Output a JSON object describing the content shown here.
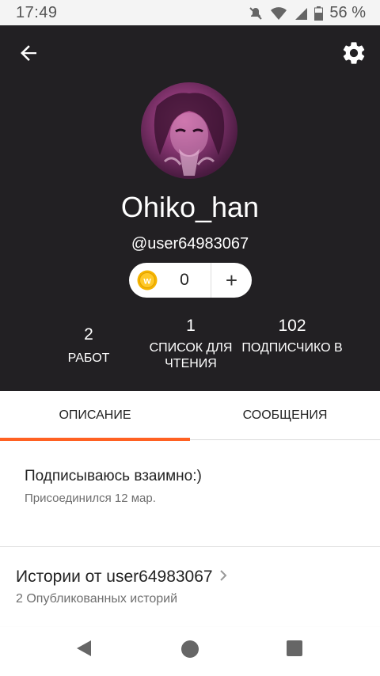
{
  "status_bar": {
    "time": "17:49",
    "battery": "56 %"
  },
  "profile": {
    "username": "Ohiko_han",
    "handle": "@user64983067",
    "coins": "0",
    "add_coins": "+",
    "stats": [
      {
        "value": "2",
        "label": "РАБОТ"
      },
      {
        "value": "1",
        "label": "СПИСОК ДЛЯ ЧТЕНИЯ"
      },
      {
        "value": "102",
        "label": "ПОДПИСЧИКО В"
      }
    ]
  },
  "tabs": [
    {
      "label": "ОПИСАНИЕ",
      "active": true
    },
    {
      "label": "СООБЩЕНИЯ",
      "active": false
    }
  ],
  "about": {
    "text": "Подписываюсь взаимно:)",
    "joined": "Присоединился 12 мар."
  },
  "stories": {
    "title": "Истории от user64983067",
    "count": "2 Опубликованных историй"
  },
  "icons": {
    "back": "back-arrow-icon",
    "settings": "gear-icon",
    "coin": "wattpad-coin-icon",
    "chevron": "chevron-right-icon"
  },
  "colors": {
    "accent": "#ff6122",
    "header_bg": "#222023"
  }
}
